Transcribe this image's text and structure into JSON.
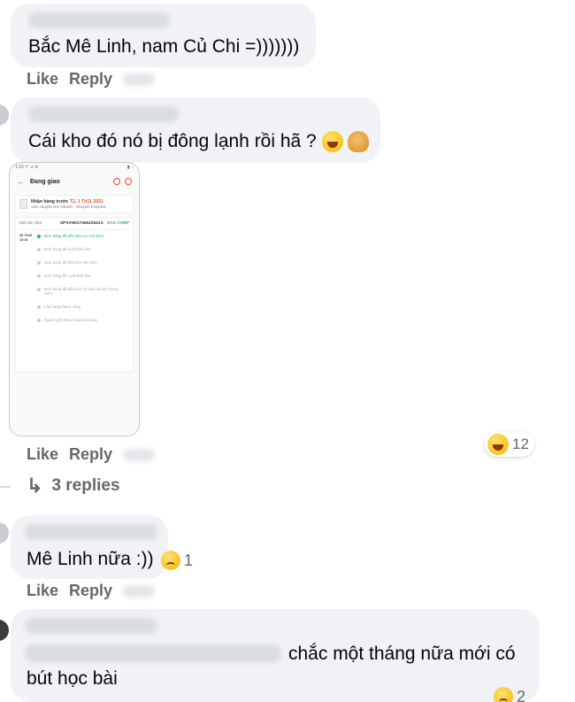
{
  "comments": [
    {
      "text": "Bắc Mê Linh, nam Củ Chi =)))))))",
      "like": "Like",
      "reply": "Reply"
    },
    {
      "text": "Cái kho đó nó bị đông lạnh rồi hã ?",
      "like": "Like",
      "reply": "Reply",
      "reaction_count": "12",
      "replies_label": "3 replies",
      "emojis": [
        "face-with-tears-of-joy",
        "person-facepalming"
      ]
    },
    {
      "text": "Mê Linh nữa :))",
      "like": "Like",
      "reply": "Reply",
      "reaction_count": "1"
    },
    {
      "text_line1": "chắc một tháng nữa mới có",
      "text_line2": "bút học bài",
      "reaction_count": "2"
    }
  ],
  "attachment": {
    "status_left": "1:16 ⁵⁰ ⊿ ✉",
    "status_right": "▮ ◌",
    "header": "Đang giao",
    "receive_label": "Nhận hàng trước",
    "receive_date": "T2, 1 Th11 2021",
    "carrier": "Vận chuyển bởi Nhanh - Shopee Express",
    "tracking_label": "Mã vận đơn",
    "tracking_no": "SPXVN01746522541A",
    "copy_label": "SAO CHÉP",
    "events": [
      {
        "time": "30 Th10 12:41",
        "text": "Đơn hàng đã đến kho Cu Chi SOC"
      },
      {
        "time": "",
        "text": "Đơn hàng đã xuất khỏi kho"
      },
      {
        "time": "",
        "text": "Đơn hàng đã đến kho HN SOC"
      },
      {
        "time": "",
        "text": "Đơn hàng đã xuất khỏi kho"
      },
      {
        "time": "",
        "text": "Đơn hàng đã đến kho 20 Hải Hai Ba Trưng SOC"
      },
      {
        "time": "",
        "text": "Lấy hàng thành công"
      },
      {
        "time": "",
        "text": "Người gửi đang chuẩn bị hàng"
      }
    ]
  },
  "colors": {
    "bubble": "#f0f2f5",
    "meta": "#65676b",
    "shopee": "#ee4d2d",
    "teal": "#26aa99"
  }
}
